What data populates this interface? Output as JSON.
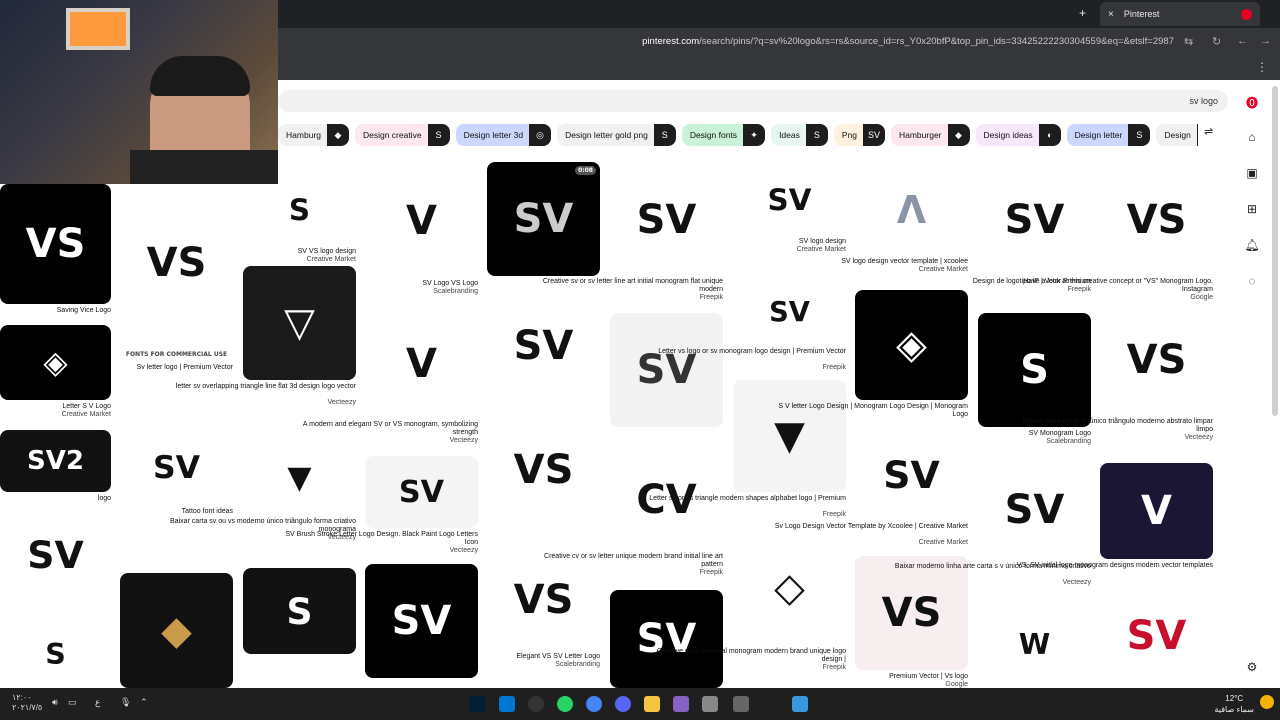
{
  "browser": {
    "tab_title": "Pinterest",
    "close_icon": "×",
    "new_tab_icon": "+",
    "url_host": "pinterest.com",
    "url_path": "/search/pins/?q=sv%20logo&rs=rs&source_id=rs_Y0x20bfP&top_pin_ids=33425222230304559&eq=&etslf=2987",
    "menu_icon": "⋮"
  },
  "search": {
    "query": "sv logo"
  },
  "chips": [
    {
      "label": "Hamburg",
      "bg": "#f1f1f1",
      "thumb": "◆"
    },
    {
      "label": "Design creative",
      "bg": "#fde8f0",
      "thumb": "S"
    },
    {
      "label": "Design letter 3d",
      "bg": "#cbd7ff",
      "thumb": "◎"
    },
    {
      "label": "Design letter gold png",
      "bg": "#f1f1f1",
      "thumb": "S"
    },
    {
      "label": "Design fonts",
      "bg": "#c9f2d8",
      "thumb": "✦"
    },
    {
      "label": "Ideas",
      "bg": "#e7f7ef",
      "thumb": "S"
    },
    {
      "label": "Png",
      "bg": "#fff1e0",
      "thumb": "SV"
    },
    {
      "label": "Hamburger",
      "bg": "#fde8f0",
      "thumb": "◆"
    },
    {
      "label": "Design ideas",
      "bg": "#f6e7fb",
      "thumb": "◐"
    },
    {
      "label": "Design letter",
      "bg": "#cbd7ff",
      "thumb": "S"
    },
    {
      "label": "Design",
      "bg": "#f1f1f1",
      "thumb": "S"
    }
  ],
  "pins": [
    {
      "glyph": "VS",
      "title": "Saving Vice Logo",
      "source": "",
      "bg": "#000000",
      "fg": "#ffffff"
    },
    {
      "glyph": "◈",
      "title": "Letter S V Logo",
      "source": "Creative Market",
      "bg": "#000000",
      "fg": "#ffffff"
    },
    {
      "glyph": "SV2",
      "title": "logo",
      "source": "",
      "bg": "#111111",
      "fg": "#ffffff"
    },
    {
      "glyph": "SV",
      "title": "",
      "source": "",
      "bg": "#ffffff",
      "fg": "#111111"
    },
    {
      "glyph": "S",
      "title": "",
      "source": "",
      "bg": "#ffffff",
      "fg": "#111111"
    },
    {
      "glyph": "VS",
      "title": "",
      "source": "",
      "bg": "#ffffff",
      "fg": "#111111"
    },
    {
      "glyph": "FONTS FOR COMMERCIAL USE",
      "title": "Sv letter logo | Premium Vector",
      "source": "",
      "bg": "#ffffff",
      "fg": "#444444"
    },
    {
      "glyph": "SV",
      "title": "Tattoo font ideas",
      "source": "",
      "bg": "#ffffff",
      "fg": "#111111"
    },
    {
      "glyph": "◆",
      "title": "",
      "source": "",
      "bg": "#111111",
      "fg": "#c89a4a"
    },
    {
      "glyph": "S",
      "title": "SV VS logo design",
      "source": "Creative Market",
      "bg": "#ffffff",
      "fg": "#111111"
    },
    {
      "glyph": "▽",
      "title": "letter sv overlapping triangle line flat 3d design logo vector",
      "source": "Vecteezy",
      "bg": "#1a1a1a",
      "fg": "#ffffff"
    },
    {
      "glyph": "▼",
      "title": "Baixar carta sv ou vs moderno único triângulo forma criativo monograma",
      "source": "Vecteezy",
      "bg": "#ffffff",
      "fg": "#111111"
    },
    {
      "glyph": "S",
      "title": "",
      "source": "",
      "bg": "#111111",
      "fg": "#ffffff"
    },
    {
      "glyph": "",
      "title": "",
      "source": "",
      "bg": "#ffffff",
      "fg": "#e60023"
    },
    {
      "glyph": "V",
      "title": "SV Logo VS Logo",
      "source": "Scalebranding",
      "bg": "#ffffff",
      "fg": "#111111"
    },
    {
      "glyph": "V",
      "title": "A modern and elegant SV or VS monogram, symbolizing strength",
      "source": "Vecteezy",
      "bg": "#ffffff",
      "fg": "#111111"
    },
    {
      "glyph": "SV",
      "title": "SV Brush Stroke Letter Logo Design. Black Paint Logo Letters Icon",
      "source": "Vecteezy",
      "bg": "#f4f4f4",
      "fg": "#111111"
    },
    {
      "glyph": "SV",
      "title": "",
      "source": "",
      "bg": "#000000",
      "fg": "#ffffff"
    },
    {
      "glyph": "SV",
      "title": "",
      "source": "",
      "bg": "#000000",
      "fg": "#cccccc"
    },
    {
      "glyph": "SV",
      "title": "",
      "source": "",
      "bg": "#ffffff",
      "fg": "#111111"
    },
    {
      "glyph": "VS",
      "title": "",
      "source": "",
      "bg": "#ffffff",
      "fg": "#111111"
    },
    {
      "glyph": "VS",
      "title": "Elegant VS SV Letter Logo",
      "source": "Scalebranding",
      "bg": "#ffffff",
      "fg": "#111111"
    },
    {
      "glyph": "SV",
      "title": "Creative sv or sv letter line art initial monogram flat unique modern",
      "source": "Freepik",
      "bg": "#ffffff",
      "fg": "#111111"
    },
    {
      "glyph": "SV",
      "title": "",
      "source": "",
      "bg": "#f2f2f2",
      "fg": "#333333"
    },
    {
      "glyph": "CV",
      "title": "Creative cv or sv letter unique modern brand initial line art pattern",
      "source": "Freepik",
      "bg": "#ffffff",
      "fg": "#111111"
    },
    {
      "glyph": "SV",
      "title": "",
      "source": "",
      "bg": "#000000",
      "fg": "#ffffff"
    },
    {
      "glyph": "SV",
      "title": "SV logo design",
      "source": "Creative Market",
      "bg": "#ffffff",
      "fg": "#111111"
    },
    {
      "glyph": "SV",
      "title": "Letter vs logo or sv monogram logo design | Premium Vector",
      "source": "Freepik",
      "bg": "#ffffff",
      "fg": "#111111"
    },
    {
      "glyph": "▼",
      "title": "Letter sv or vs triangle modern shapes alphabet logo | Premium",
      "source": "Freepik",
      "bg": "#f4f4f4",
      "fg": "#111111"
    },
    {
      "glyph": "◇",
      "title": "Creative sv or vs initial monogram modern brand unique logo design |",
      "source": "Freepik",
      "bg": "#ffffff",
      "fg": "#111111"
    },
    {
      "glyph": "ᐱ",
      "title": "SV logo design vector template | xcoolee",
      "source": "Creative Market",
      "bg": "#ffffff",
      "fg": "#8a94a8"
    },
    {
      "glyph": "◈",
      "title": "S V letter Logo Design | Monogram Logo Design | Monogram Logo",
      "source": "",
      "bg": "#000000",
      "fg": "#ffffff"
    },
    {
      "glyph": "SV",
      "title": "Sv Logo Design Vector Template by Xcoolee | Creative Market",
      "source": "Creative Market",
      "bg": "#ffffff",
      "fg": "#111111"
    },
    {
      "glyph": "VS",
      "title": "Premium Vector | Vs logo",
      "source": "Google",
      "bg": "#f7eeef",
      "fg": "#111111"
    },
    {
      "glyph": "SV",
      "title": "Design de logotipo IF | Vetor Premium",
      "source": "Freepik",
      "bg": "#ffffff",
      "fg": "#111111"
    },
    {
      "glyph": "S",
      "title": "SV Monogram Logo",
      "source": "Scalebranding",
      "bg": "#000000",
      "fg": "#ffffff"
    },
    {
      "glyph": "SV",
      "title": "Baixar moderno linha arte carta s v único forma mínimo criativo",
      "source": "Vecteezy",
      "bg": "#ffffff",
      "fg": "#111111"
    },
    {
      "glyph": "W",
      "title": "",
      "source": "",
      "bg": "#ffffff",
      "fg": "#111111"
    },
    {
      "glyph": "VS",
      "title": "Have a look at this creative concept or \"VS\" Monogram Logo. Instagram",
      "source": "Google",
      "bg": "#ffffff",
      "fg": "#111111"
    },
    {
      "glyph": "VS",
      "title": "Baixar carta vs ou sv único triângulo moderno abstrato limpar limpo",
      "source": "Vecteezy",
      "bg": "#ffffff",
      "fg": "#111111"
    },
    {
      "glyph": "V",
      "title": "VS, SV initial logo monogram designs modern vector templates",
      "source": "",
      "bg": "#1a1633",
      "fg": "#ffffff"
    },
    {
      "glyph": "SV",
      "title": "",
      "source": "",
      "bg": "#ffffff",
      "fg": "#c8102e"
    }
  ],
  "taskbar": {
    "time": "١٢:٠٠",
    "date": "٢٠٢١/٧/٥",
    "lang": "ع",
    "temp": "12°C",
    "weather": "سماء صافية"
  },
  "colors": {
    "accent": "#e60023",
    "chip_dark": "#1d1d1d"
  }
}
